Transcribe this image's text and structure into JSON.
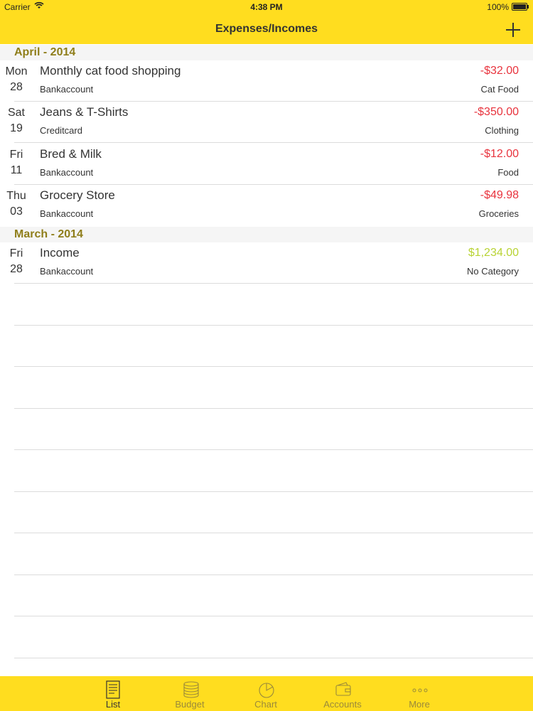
{
  "status": {
    "carrier": "Carrier",
    "time": "4:38 PM",
    "battery": "100%"
  },
  "nav": {
    "title": "Expenses/Incomes",
    "add_icon": "plus-icon"
  },
  "sections": [
    {
      "header": "April - 2014",
      "items": [
        {
          "day": "Mon",
          "date": "28",
          "title": "Monthly cat food shopping",
          "account": "Bankaccount",
          "amount": "-$32.00",
          "category": "Cat Food",
          "type": "expense"
        },
        {
          "day": "Sat",
          "date": "19",
          "title": "Jeans & T-Shirts",
          "account": "Creditcard",
          "amount": "-$350.00",
          "category": "Clothing",
          "type": "expense"
        },
        {
          "day": "Fri",
          "date": "11",
          "title": "Bred & Milk",
          "account": "Bankaccount",
          "amount": "-$12.00",
          "category": "Food",
          "type": "expense"
        },
        {
          "day": "Thu",
          "date": "03",
          "title": "Grocery Store",
          "account": "Bankaccount",
          "amount": "-$49.98",
          "category": "Groceries",
          "type": "expense"
        }
      ]
    },
    {
      "header": "March - 2014",
      "items": [
        {
          "day": "Fri",
          "date": "28",
          "title": "Income",
          "account": "Bankaccount",
          "amount": "$1,234.00",
          "category": "No Category",
          "type": "income"
        }
      ]
    }
  ],
  "tabs": [
    {
      "label": "List",
      "icon": "list-icon",
      "active": true
    },
    {
      "label": "Budget",
      "icon": "coins-icon",
      "active": false
    },
    {
      "label": "Chart",
      "icon": "pie-chart-icon",
      "active": false
    },
    {
      "label": "Accounts",
      "icon": "wallet-icon",
      "active": false
    },
    {
      "label": "More",
      "icon": "more-icon",
      "active": false
    }
  ],
  "colors": {
    "brand": "#ffdd1f",
    "section_header_text": "#8f7e1a",
    "expense": "#e8333d",
    "income": "#b8d334"
  }
}
